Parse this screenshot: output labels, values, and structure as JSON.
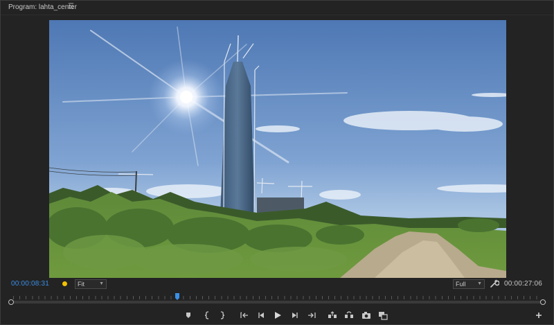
{
  "panel": {
    "title": "Program: lahta_center",
    "menu_icon": "hamburger-menu-icon"
  },
  "viewer": {
    "content": "video-frame"
  },
  "controls": {
    "current_timecode": "00:00:08:31",
    "duration_timecode": "00:00:27:06",
    "zoom_dropdown": {
      "selected": "Fit"
    },
    "resolution_dropdown": {
      "selected": "Full"
    },
    "marker_color": "#f2c200",
    "accent_color": "#3a8ee6",
    "settings_icon": "wrench-icon"
  },
  "scrubber": {
    "playhead_position": 0.31
  },
  "transport": {
    "buttons": [
      "add-marker-icon",
      "mark-in-icon",
      "mark-out-icon",
      "go-to-in-icon",
      "step-back-icon",
      "play-icon",
      "step-forward-icon",
      "go-to-out-icon",
      "lift-icon",
      "extract-icon",
      "export-frame-icon",
      "compare-view-icon",
      "add-button-icon"
    ]
  }
}
